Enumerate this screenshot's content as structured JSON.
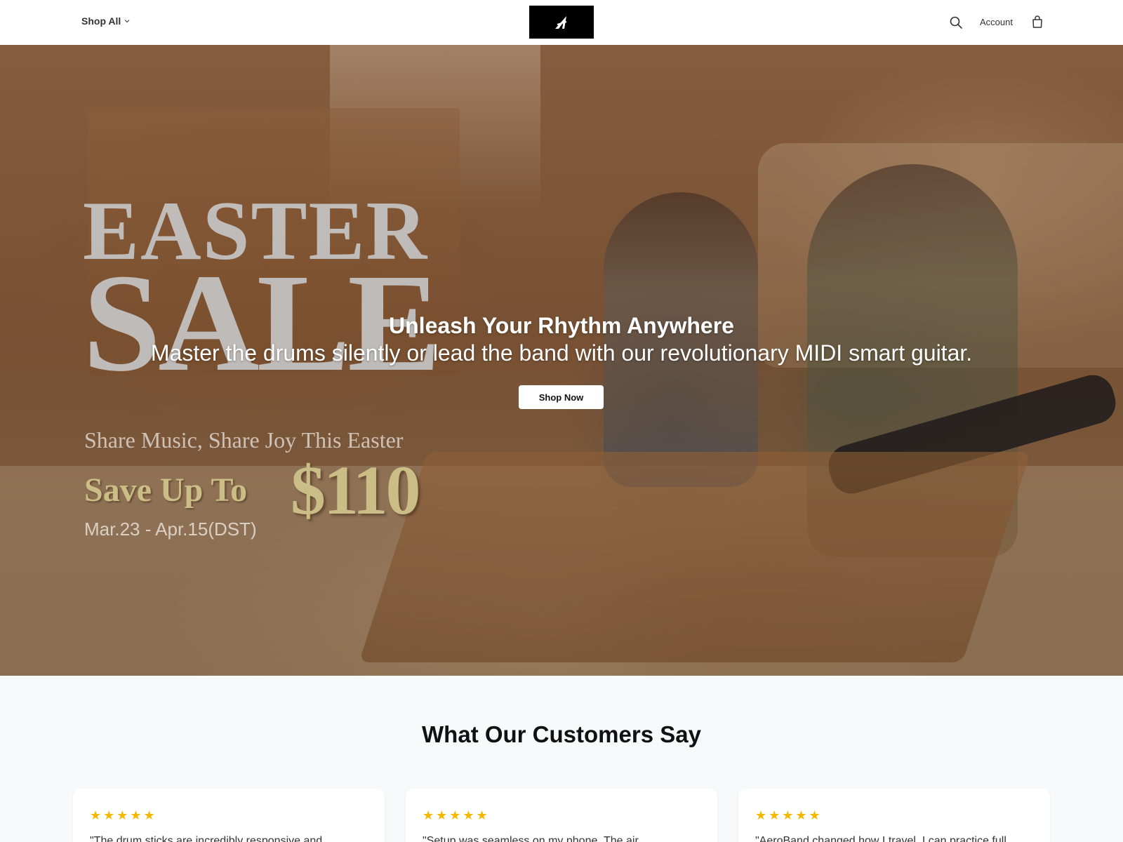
{
  "header": {
    "nav_label": "Shop All",
    "account_label": "Account",
    "logo_alt": "AeroBand logo",
    "icons": {
      "search": "search-icon",
      "cart": "bag-icon",
      "dropdown": "chevron-down-icon"
    }
  },
  "hero": {
    "promo": {
      "line1": "EASTER",
      "line2": "SALE",
      "tagline": "Share Music, Share Joy This Easter",
      "save_label": "Save Up To",
      "amount": "$110",
      "dates": "Mar.23 - Apr.15(DST)"
    },
    "title": "Unleash Your Rhythm Anywhere",
    "subtitle": "Master the drums silently or lead the band with our revolutionary MIDI smart guitar.",
    "cta_label": "Shop Now"
  },
  "testimonials": {
    "title": "What Our Customers Say",
    "items": [
      {
        "stars": "★★★★★",
        "rating": 5,
        "quote": "\"The drum sticks are incredibly responsive and"
      },
      {
        "stars": "★★★★★",
        "rating": 5,
        "quote": "\"Setup was seamless on my phone. The air"
      },
      {
        "stars": "★★★★★",
        "rating": 5,
        "quote": "\"AeroBand changed how I travel. I can practice full"
      }
    ]
  },
  "colors": {
    "star": "#f5b800",
    "promo_gold": "#cbbd86",
    "header_bg": "#ffffff",
    "page_bg": "#f8f9fb"
  }
}
